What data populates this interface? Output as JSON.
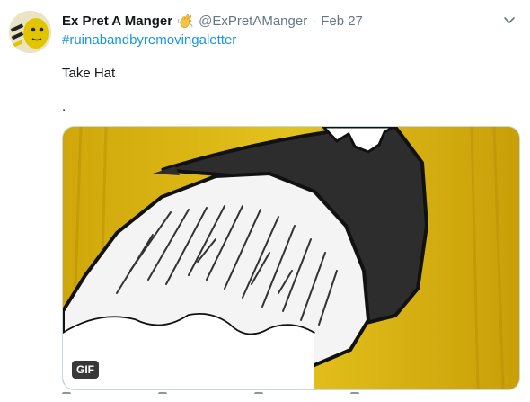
{
  "tweet": {
    "display_name": "Ex Pret A Manger",
    "name_emoji": "waving-hand-emoji",
    "handle": "@ExPretAManger",
    "separator": "·",
    "date": "Feb 27",
    "hashtag": "#ruinabandbyremovingaletter",
    "text": "Take Hat",
    "text_line2": ".",
    "media": {
      "type": "gif",
      "badge": "GIF"
    }
  },
  "colors": {
    "link": "#1b95e0",
    "muted": "#657786",
    "gif_background": "#d7b316"
  }
}
